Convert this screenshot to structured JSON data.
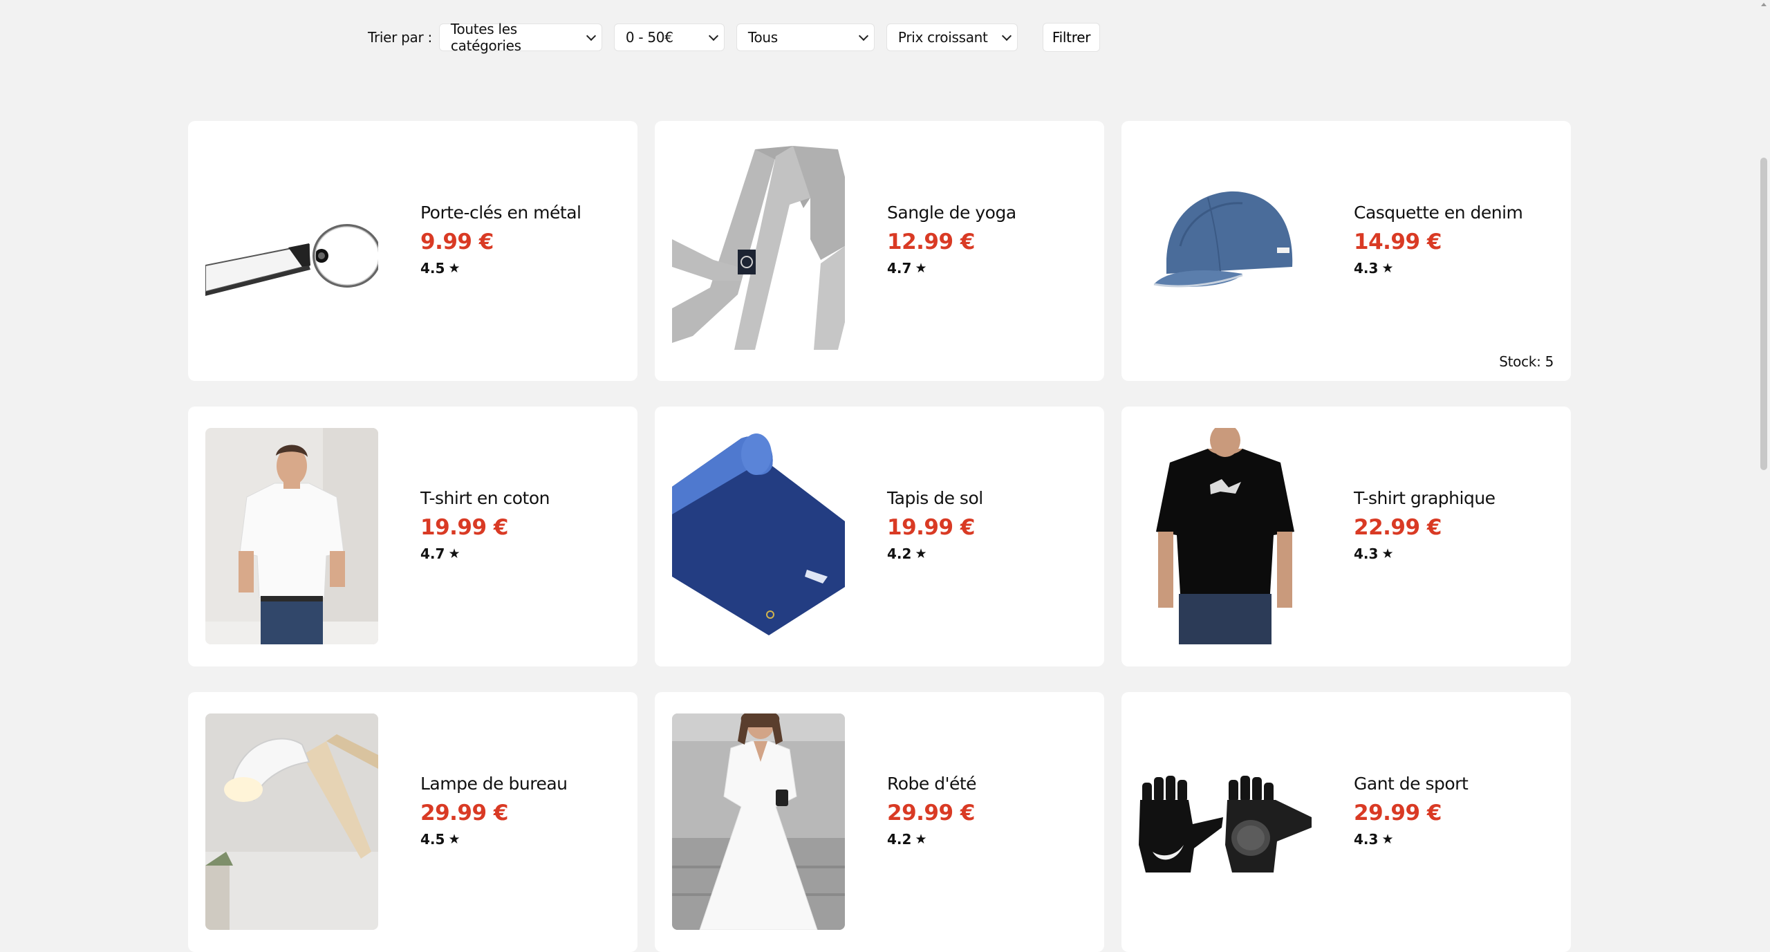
{
  "filters": {
    "sort_label": "Trier par :",
    "category": "Toutes les catégories",
    "price_range": "0 - 50€",
    "type": "Tous",
    "sort_order": "Prix croissant",
    "filter_button": "Filtrer"
  },
  "products": [
    {
      "name": "Porte-clés en métal",
      "price": "9.99 €",
      "rating": "4.5",
      "image": "keychain-image",
      "stock": ""
    },
    {
      "name": "Sangle de yoga",
      "price": "12.99 €",
      "rating": "4.7",
      "image": "yoga-strap-image",
      "stock": ""
    },
    {
      "name": "Casquette en denim",
      "price": "14.99 €",
      "rating": "4.3",
      "image": "denim-cap-image",
      "stock": "Stock: 5"
    },
    {
      "name": "T-shirt en coton",
      "price": "19.99 €",
      "rating": "4.7",
      "image": "cotton-tshirt-image",
      "stock": ""
    },
    {
      "name": "Tapis de sol",
      "price": "19.99 €",
      "rating": "4.2",
      "image": "floor-mat-image",
      "stock": ""
    },
    {
      "name": "T-shirt graphique",
      "price": "22.99 €",
      "rating": "4.3",
      "image": "graphic-tshirt-image",
      "stock": ""
    },
    {
      "name": "Lampe de bureau",
      "price": "29.99 €",
      "rating": "4.5",
      "image": "desk-lamp-image",
      "stock": ""
    },
    {
      "name": "Robe d'été",
      "price": "29.99 €",
      "rating": "4.2",
      "image": "summer-dress-image",
      "stock": ""
    },
    {
      "name": "Gant de sport",
      "price": "29.99 €",
      "rating": "4.3",
      "image": "sport-gloves-image",
      "stock": ""
    }
  ],
  "colors": {
    "price": "#d93a24",
    "background": "#f2f2f2",
    "card": "#ffffff"
  }
}
